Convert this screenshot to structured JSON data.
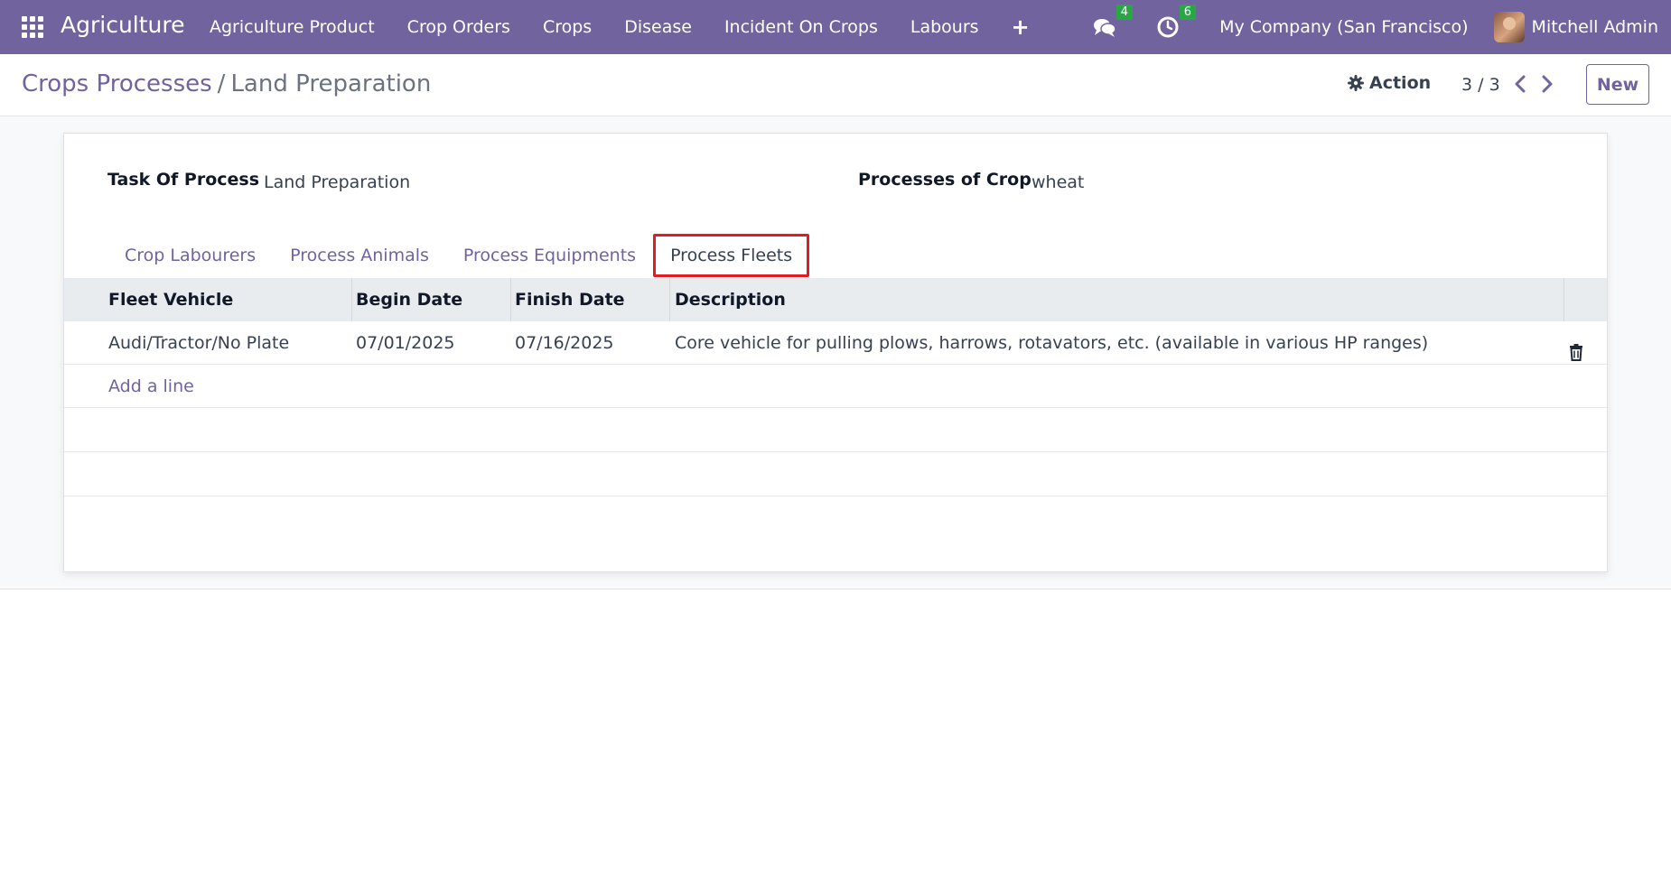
{
  "navbar": {
    "brand": "Agriculture",
    "menu": [
      "Agriculture Product",
      "Crop Orders",
      "Crops",
      "Disease",
      "Incident On Crops",
      "Labours"
    ],
    "plus": "+",
    "messages_count": "4",
    "activities_count": "6",
    "company": "My Company (San Francisco)",
    "user": "Mitchell Admin",
    "accent": "#71639e"
  },
  "control": {
    "breadcrumb_parent": "Crops Processes",
    "breadcrumb_sep": "/",
    "breadcrumb_current": "Land Preparation",
    "action_label": "Action",
    "pager": "3 / 3",
    "new_label": "New"
  },
  "form": {
    "task_label": "Task Of Process",
    "task_value": "Land Preparation",
    "crop_label": "Processes of Crop",
    "crop_value": "wheat"
  },
  "tabs": [
    "Crop Labourers",
    "Process Animals",
    "Process Equipments",
    "Process Fleets"
  ],
  "active_tab": "Process Fleets",
  "table": {
    "headers": [
      "Fleet Vehicle",
      "Begin Date",
      "Finish Date",
      "Description"
    ],
    "rows": [
      {
        "vehicle": "Audi/Tractor/No Plate",
        "begin": "07/01/2025",
        "finish": "07/16/2025",
        "description": "Core vehicle for pulling plows, harrows, rotavators, etc. (available in various HP ranges)"
      }
    ],
    "add_line": "Add a line"
  }
}
